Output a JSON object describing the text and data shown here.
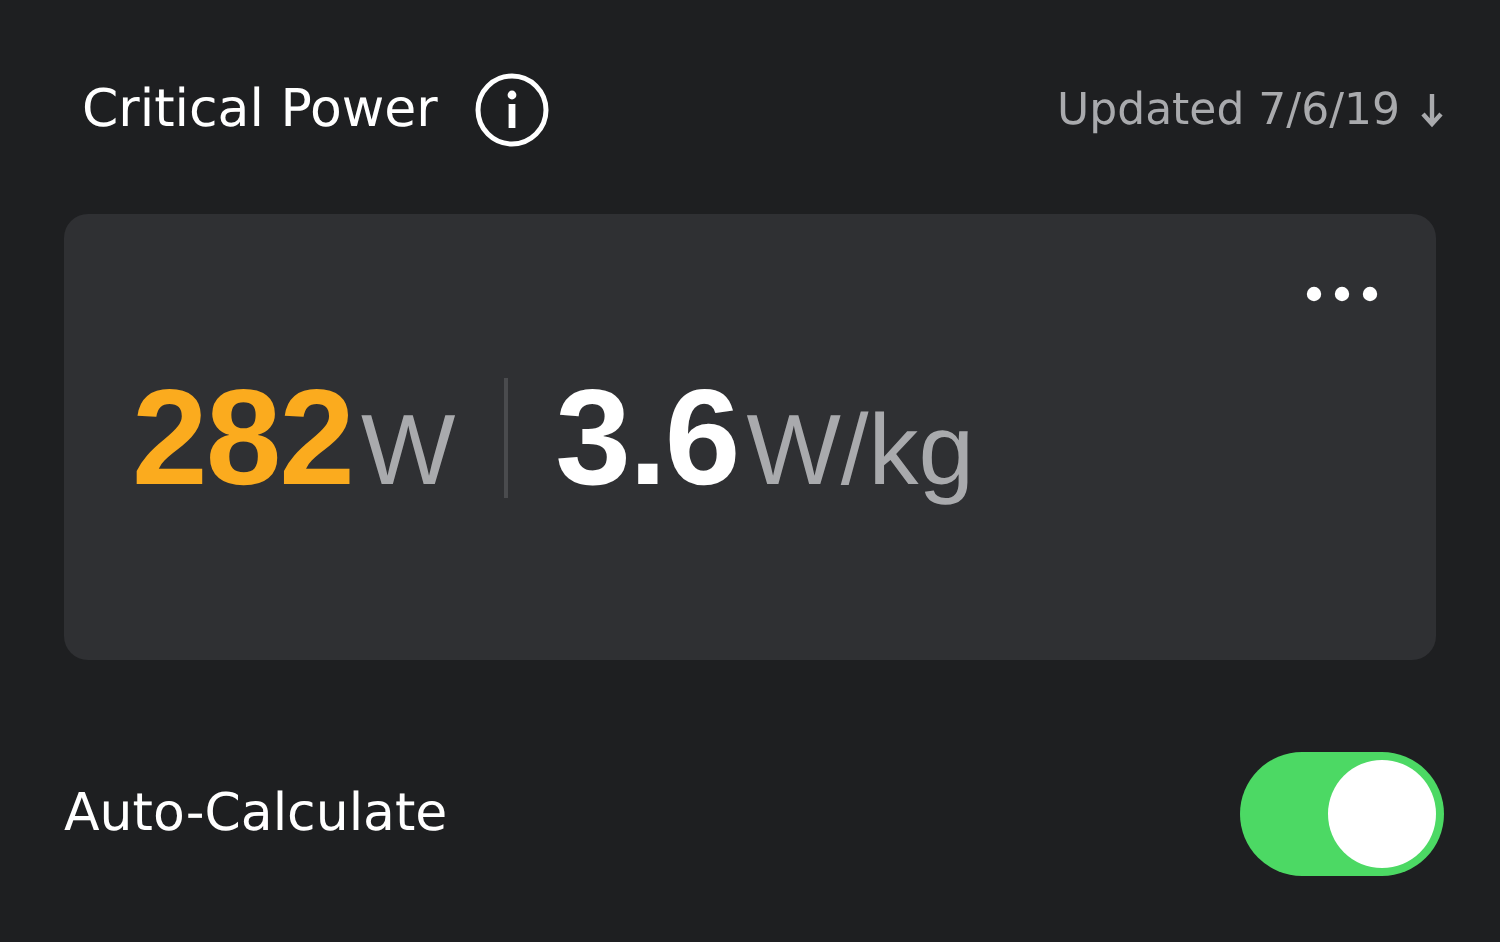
{
  "header": {
    "title": "Critical Power",
    "updated": "Updated 7/6/19"
  },
  "card": {
    "metrics": [
      {
        "value": "282",
        "unit": "W",
        "color": "#fbab1e"
      },
      {
        "value": "3.6",
        "unit": "W/kg",
        "color": "#ffffff"
      }
    ]
  },
  "auto_calculate": {
    "label": "Auto-Calculate",
    "on": true
  }
}
